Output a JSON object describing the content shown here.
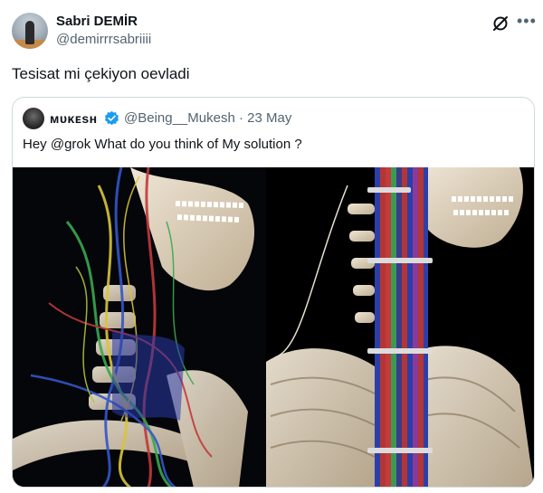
{
  "author": {
    "name": "Sabri DEMİR",
    "handle": "@demirrrsabriiii"
  },
  "tweet": {
    "text": "Tesisat mi çekiyon oevladi"
  },
  "quoted": {
    "name": "ᴍᴜᴋᴇsʜ",
    "handle": "@Being__Mukesh",
    "separator": "·",
    "date": "23 May",
    "text": "Hey @grok What do you think of My solution ?"
  },
  "icons": {
    "more": "more-options-icon",
    "grok": "grok-icon",
    "verified": "verified-badge-icon"
  },
  "colors": {
    "verified": "#1d9bf0",
    "secondary_text": "#536471",
    "border": "#cfd9de"
  }
}
